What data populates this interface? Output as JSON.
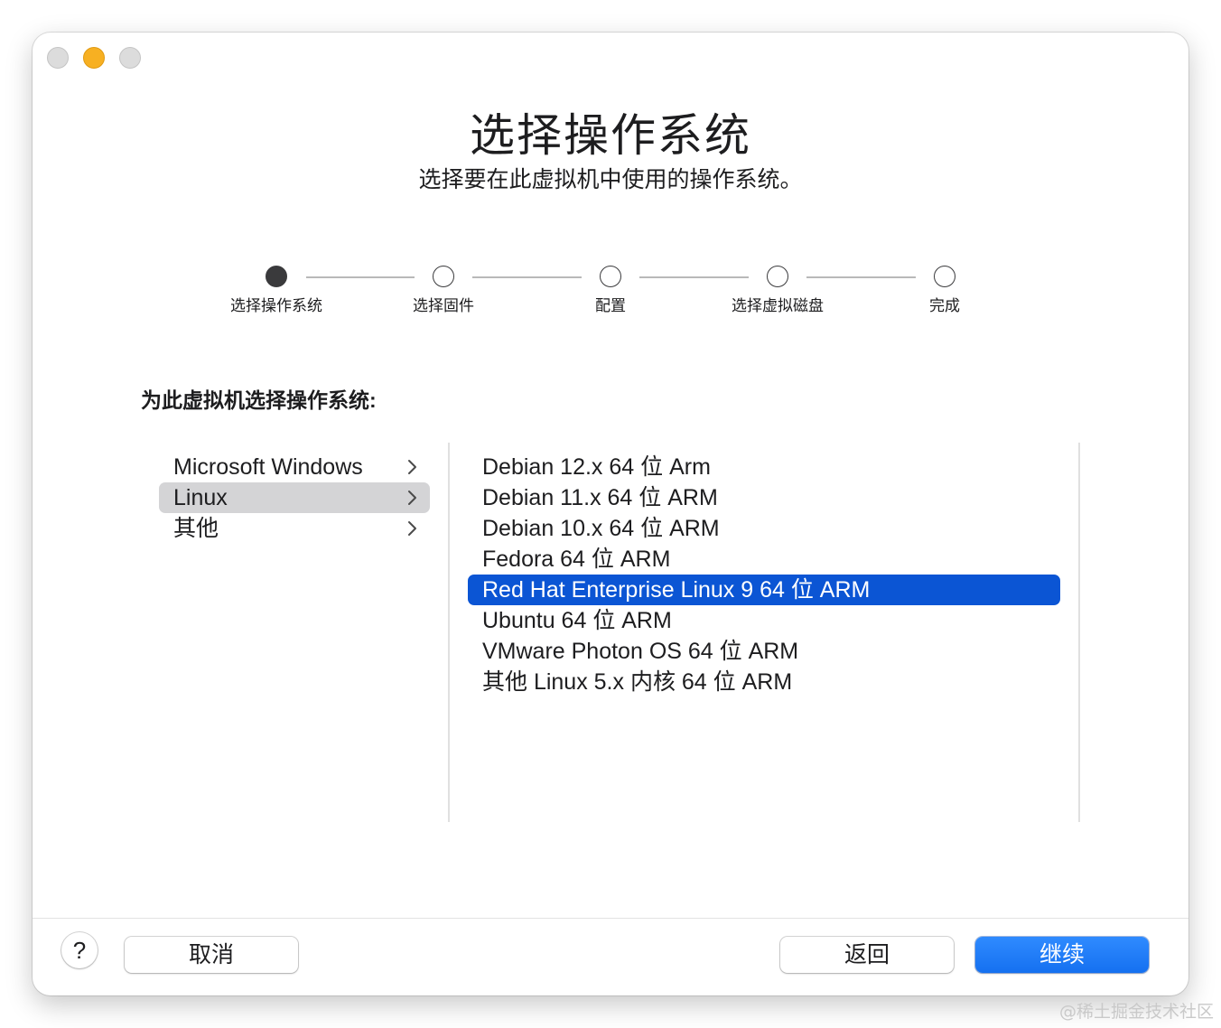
{
  "window": {
    "title": "选择操作系统",
    "subtitle": "选择要在此虚拟机中使用的操作系统。"
  },
  "steps": [
    {
      "label": "选择操作系统",
      "active": true
    },
    {
      "label": "选择固件",
      "active": false
    },
    {
      "label": "配置",
      "active": false
    },
    {
      "label": "选择虚拟磁盘",
      "active": false
    },
    {
      "label": "完成",
      "active": false
    }
  ],
  "section_label": "为此虚拟机选择操作系统:",
  "categories": [
    {
      "label": "Microsoft Windows",
      "selected": false
    },
    {
      "label": "Linux",
      "selected": true
    },
    {
      "label": "其他",
      "selected": false
    }
  ],
  "os_list": [
    {
      "label": "Debian 12.x 64 位 Arm",
      "selected": false
    },
    {
      "label": "Debian 11.x 64 位 ARM",
      "selected": false
    },
    {
      "label": "Debian 10.x 64 位 ARM",
      "selected": false
    },
    {
      "label": "Fedora 64 位 ARM",
      "selected": false
    },
    {
      "label": "Red Hat Enterprise Linux 9 64 位 ARM",
      "selected": true
    },
    {
      "label": "Ubuntu 64 位 ARM",
      "selected": false
    },
    {
      "label": "VMware Photon OS 64 位 ARM",
      "selected": false
    },
    {
      "label": "其他 Linux 5.x 内核 64 位 ARM",
      "selected": false
    }
  ],
  "footer": {
    "help_label": "?",
    "cancel_label": "取消",
    "back_label": "返回",
    "continue_label": "继续"
  },
  "watermark": "@稀土掘金技术社区",
  "colors": {
    "accent": "#0b55d4",
    "primary_button": "#1570f0",
    "minimize": "#f7b022",
    "category_selected": "#d4d4d6"
  },
  "icons": {
    "chevron": "chevron-right-icon"
  }
}
